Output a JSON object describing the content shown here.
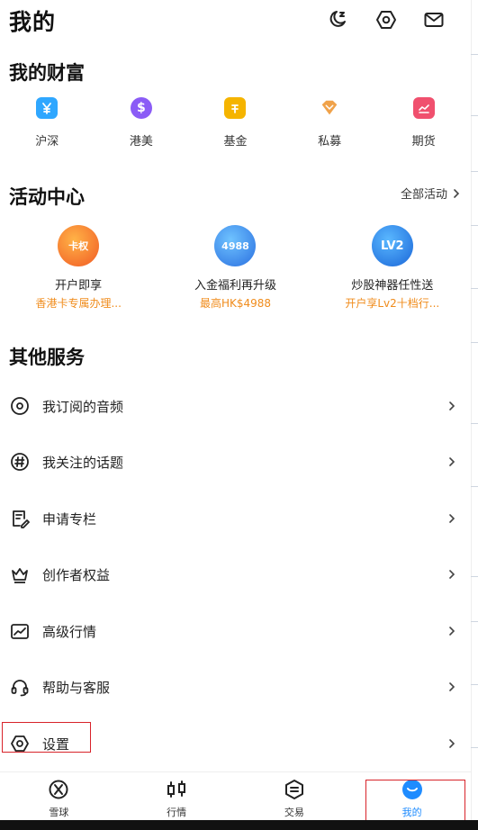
{
  "header": {
    "title": "我的"
  },
  "wealth": {
    "title": "我的财富",
    "items": [
      {
        "label": "沪深",
        "icon": "cny-icon",
        "color": "#2fa7ff"
      },
      {
        "label": "港美",
        "icon": "dollar-icon",
        "color": "#8b5cf6"
      },
      {
        "label": "基金",
        "icon": "fund-bag-icon",
        "color": "#f5b400"
      },
      {
        "label": "私募",
        "icon": "diamond-icon",
        "color": "#f0a24a"
      },
      {
        "label": "期货",
        "icon": "futures-chart-icon",
        "color": "#f0506e"
      }
    ]
  },
  "activities": {
    "title": "活动中心",
    "all_label": "全部活动",
    "items": [
      {
        "name": "开户即享",
        "sub": "香港卡专属办理...",
        "badge": "卡权"
      },
      {
        "name": "入金福利再升级",
        "sub": "最高HK$4988",
        "badge": "4988"
      },
      {
        "name": "炒股神器任性送",
        "sub": "开户享Lv2十档行...",
        "badge": "LV2"
      }
    ]
  },
  "services": {
    "title": "其他服务",
    "items": [
      {
        "label": "我订阅的音频",
        "icon": "audio-disc-icon"
      },
      {
        "label": "我关注的话题",
        "icon": "hashtag-icon"
      },
      {
        "label": "申请专栏",
        "icon": "edit-doc-icon"
      },
      {
        "label": "创作者权益",
        "icon": "crown-icon"
      },
      {
        "label": "高级行情",
        "icon": "trend-chart-icon"
      },
      {
        "label": "帮助与客服",
        "icon": "headset-icon"
      },
      {
        "label": "设置",
        "icon": "settings-hexagon-icon"
      }
    ]
  },
  "tabs": [
    {
      "label": "雪球",
      "icon": "snowball-icon"
    },
    {
      "label": "行情",
      "icon": "candlestick-icon"
    },
    {
      "label": "交易",
      "icon": "trade-icon"
    },
    {
      "label": "我的",
      "icon": "me-icon",
      "active": true
    }
  ]
}
